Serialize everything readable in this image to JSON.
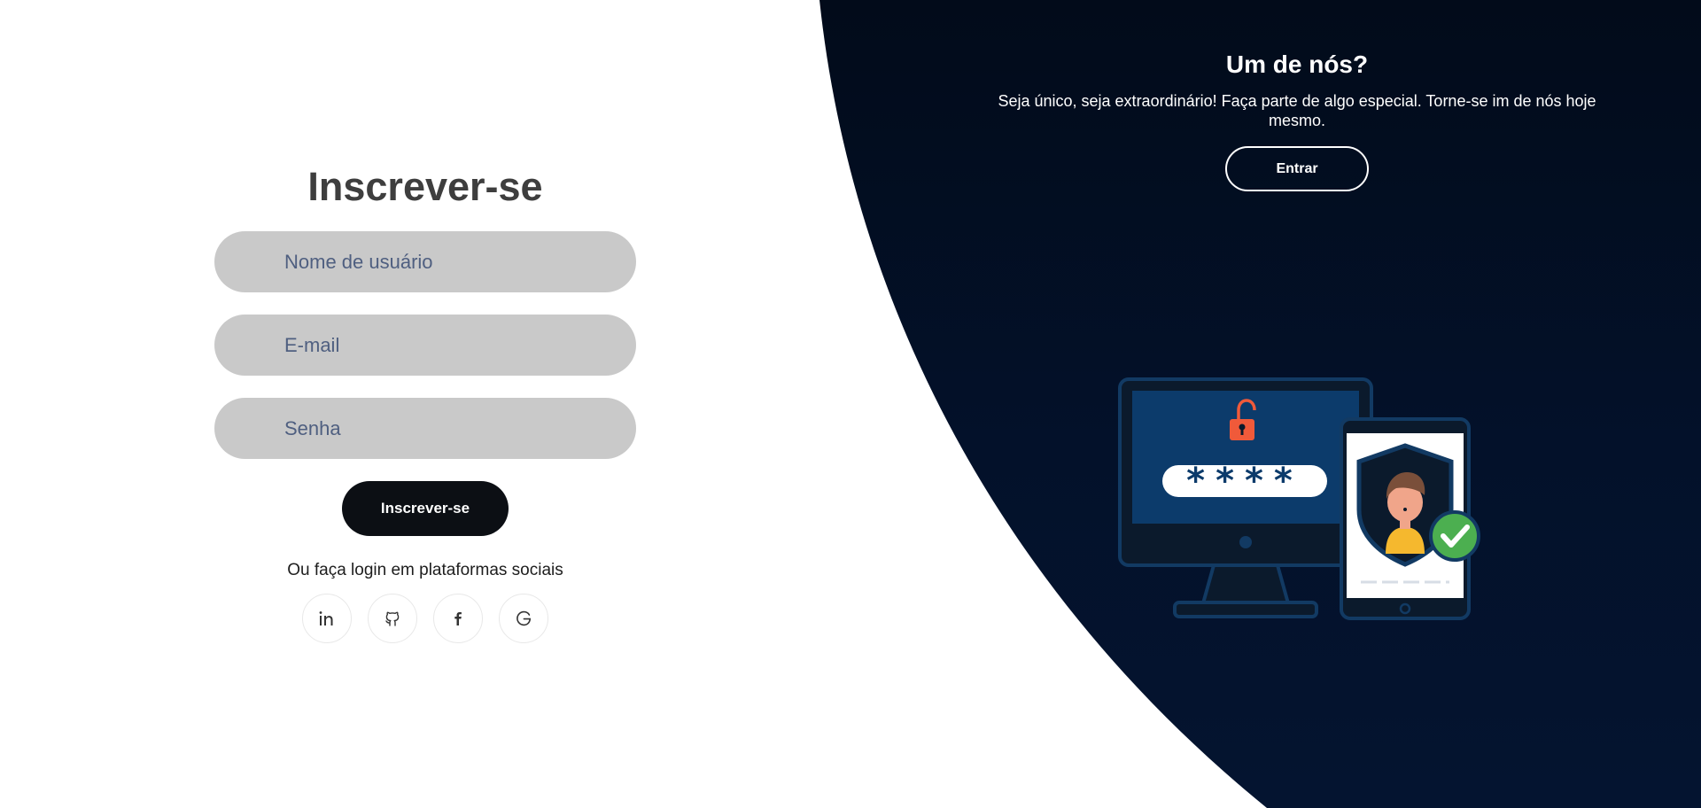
{
  "signup": {
    "title": "Inscrever-se",
    "username_placeholder": "Nome de usuário",
    "email_placeholder": "E-mail",
    "password_placeholder": "Senha",
    "submit_label": "Inscrever-se",
    "social_text": "Ou faça login em plataformas sociais",
    "social_icons": [
      "linkedin-icon",
      "github-icon",
      "facebook-icon",
      "google-icon"
    ]
  },
  "panel": {
    "title": "Um de nós?",
    "text": "Seja único, seja extraordinário! Faça parte de algo especial. Torne-se im de nós hoje mesmo.",
    "button_label": "Entrar",
    "password_mask": "****"
  },
  "colors": {
    "panel_bg": "#020b1a",
    "field_bg": "#c9c9c9",
    "button_bg": "#0c0f14",
    "title": "#3e3e3e"
  }
}
